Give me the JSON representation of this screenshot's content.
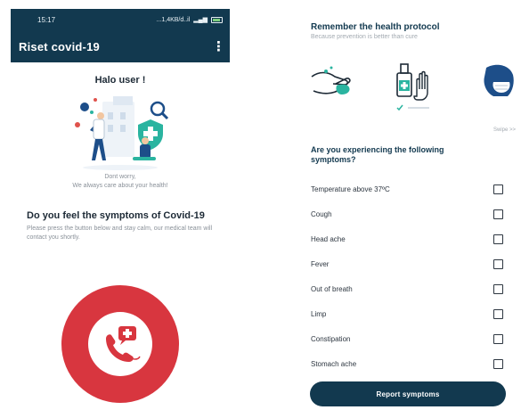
{
  "left_screen": {
    "status_bar": {
      "time": "15:17",
      "network": "...1,4KB/d..il",
      "signal": "Sail"
    },
    "app_bar": {
      "title": "Riset covid-19",
      "menu_icon": "kebab-menu-icon"
    },
    "greeting": "Halo user !",
    "reassurance": [
      "Dont worry,",
      "We always care about your health!"
    ],
    "question_title": "Do you feel the symptoms of Covid-19",
    "question_desc": "Please press the button below and stay calm, our medical team will contact you shortly.",
    "emergency_button": {
      "icon": "emergency-phone-icon",
      "color": "#d8363f"
    }
  },
  "right_screen": {
    "protocol_title": "Remember the health protocol",
    "protocol_subtitle": "Because prevention is better than cure",
    "protocol_cards": [
      {
        "icon": "hand-washing-icon"
      },
      {
        "icon": "hand-sanitizer-icon",
        "active": true
      },
      {
        "icon": "face-mask-icon"
      }
    ],
    "swipe_hint": "Swipe >>",
    "symptom_question": "Are you experiencing the following symptoms?",
    "symptoms": [
      {
        "label": "Temperature above 37ºC",
        "checked": false
      },
      {
        "label": "Cough",
        "checked": false
      },
      {
        "label": "Head ache",
        "checked": false
      },
      {
        "label": "Fever",
        "checked": false
      },
      {
        "label": "Out of breath",
        "checked": false
      },
      {
        "label": "Limp",
        "checked": false
      },
      {
        "label": "Constipation",
        "checked": false
      },
      {
        "label": "Stomach ache",
        "checked": false
      }
    ],
    "report_button": "Report symptoms"
  },
  "colors": {
    "primary": "#12394f",
    "accent_red": "#d8363f",
    "teal": "#2ab4a0",
    "text_muted": "#8a9199"
  }
}
